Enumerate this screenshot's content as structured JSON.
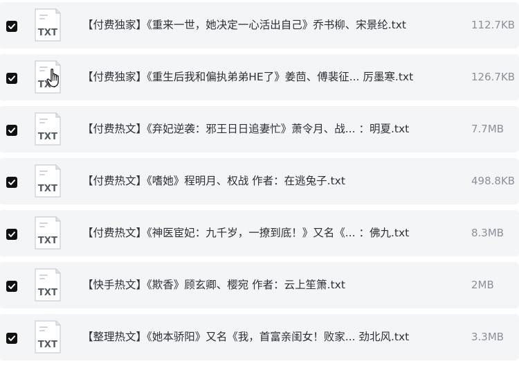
{
  "files": [
    {
      "name": "【付费独家】《重来一世，她决定一心活出自己》乔书柳、宋景纶.txt",
      "size": "112.7KB",
      "icon_label": "TXT",
      "checked": true
    },
    {
      "name": "【付费独家】《重生后我和偏执弟弟HE了》姜茴、傅裴征... 厉墨寒.txt",
      "size": "126.7KB",
      "icon_label": "TXT",
      "checked": true
    },
    {
      "name": "【付费热文】《弃妃逆袭：邪王日日追妻忙》萧令月、战... ：明夏.txt",
      "size": "7.7MB",
      "icon_label": "TXT",
      "checked": true
    },
    {
      "name": "【付费热文】《嗜她》程明月、权战 作者：在逃兔子.txt",
      "size": "498.8KB",
      "icon_label": "TXT",
      "checked": true
    },
    {
      "name": "【付费热文】《神医宦妃：九千岁，一撩到底！》又名《... ：佛九.txt",
      "size": "8.3MB",
      "icon_label": "TXT",
      "checked": true
    },
    {
      "name": "【快手热文】《欺香》顾玄卿、樱宛 作者：云上笙箫.txt",
      "size": "2MB",
      "icon_label": "TXT",
      "checked": true
    },
    {
      "name": "【整理热文】《她本骄阳》又名《我，首富亲闺女！败家... 劲北风.txt",
      "size": "3.3MB",
      "icon_label": "TXT",
      "checked": true
    }
  ],
  "colors": {
    "row_background": "#f4f5f7",
    "checkbox": "#111111",
    "name_text": "#2b2f36",
    "size_text": "#8a9099"
  },
  "icons": {
    "checkbox": "checkmark-icon",
    "file": "txt-file-icon",
    "cursor": "hand-pointer-icon"
  }
}
